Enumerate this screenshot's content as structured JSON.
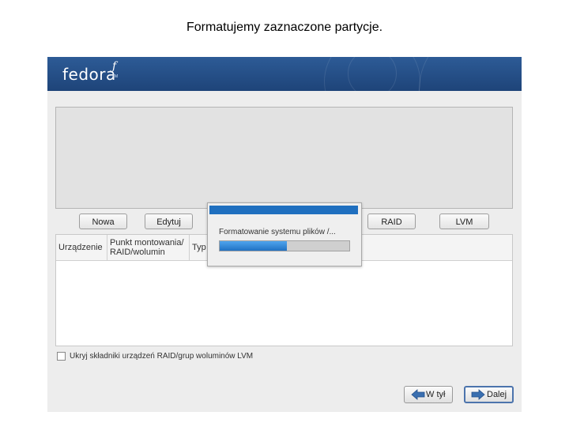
{
  "slide": {
    "title": "Formatujemy zaznaczone partycje."
  },
  "header": {
    "logo": "fedora",
    "logo_mark": "ƒ",
    "logo_tm": "TM"
  },
  "toolbar": {
    "new_label": "Nowa",
    "edit_label": "Edytuj",
    "raid_label": "RAID",
    "lvm_label": "LVM"
  },
  "table": {
    "columns": [
      "Urządzenie",
      "Punkt montowania/ RAID/wolumin",
      "Typ"
    ]
  },
  "options": {
    "hide_raid_lvm_label": "Ukryj składniki urządzeń RAID/grup woluminów LVM",
    "hide_raid_lvm_checked": false
  },
  "navigation": {
    "back_label": "W tył",
    "next_label": "Dalej"
  },
  "dialog": {
    "message": "Formatowanie systemu plików /...",
    "progress": 0.52,
    "progress_color": "#2b82d6"
  },
  "colors": {
    "header_blue": "#1e4479",
    "dialog_title_blue": "#1f6fbf"
  }
}
